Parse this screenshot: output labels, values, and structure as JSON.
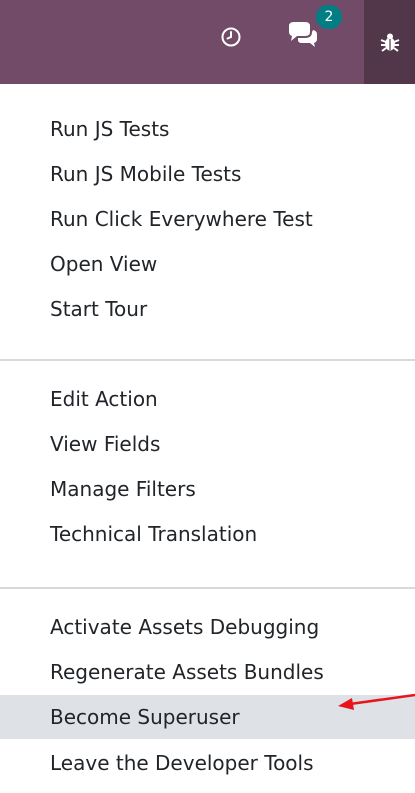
{
  "navbar": {
    "icons": {
      "clock": "clock-icon",
      "chat": "comments-icon",
      "debug": "bug-icon"
    },
    "messages_badge": "2",
    "colors": {
      "brand": "#714b67",
      "active": "#523649",
      "badge": "#017e84"
    }
  },
  "debug_menu": {
    "groups": [
      {
        "items": [
          "Run JS Tests",
          "Run JS Mobile Tests",
          "Run Click Everywhere Test",
          "Open View",
          "Start Tour"
        ]
      },
      {
        "items": [
          "Edit Action",
          "View Fields",
          "Manage Filters",
          "Technical Translation"
        ]
      },
      {
        "items": [
          "Activate Assets Debugging",
          "Regenerate Assets Bundles",
          "Become Superuser",
          "Leave the Developer Tools"
        ]
      }
    ],
    "highlighted_item": "Become Superuser",
    "annotation_color": "#e8141c"
  }
}
